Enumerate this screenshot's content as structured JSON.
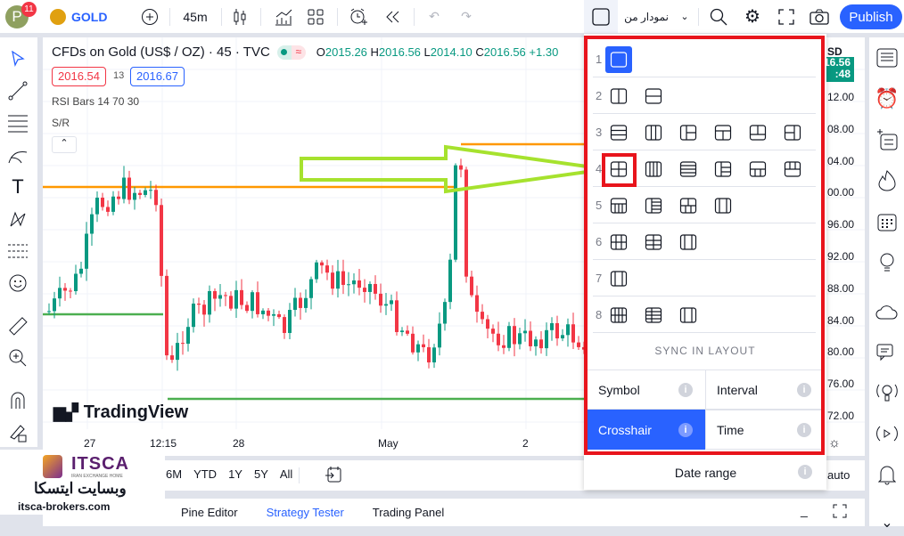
{
  "topbar": {
    "avatar_letter": "P",
    "notif_count": "11",
    "symbol": "GOLD",
    "interval": "45m",
    "layout_name": "نمودار من",
    "publish": "Publish"
  },
  "legend": {
    "title": "CFDs on Gold (US$ / OZ) · 45 · TVC",
    "o_label": "O",
    "o": "2015.26",
    "h_label": "H",
    "h": "2016.56",
    "l_label": "L",
    "l": "2014.10",
    "c_label": "C",
    "c": "2016.56",
    "change": "+1.30",
    "bid": "2016.54",
    "spread": "13",
    "ask": "2016.67",
    "ind1": "RSI Bars 14 70 30",
    "ind2": "S/R"
  },
  "price_axis": {
    "currency": "SD",
    "last": "16.56",
    "countdown": ":48",
    "labels": [
      "12.00",
      "08.00",
      "04.00",
      "00.00",
      "96.00",
      "92.00",
      "88.00",
      "84.00",
      "80.00",
      "76.00",
      "72.00"
    ]
  },
  "time_axis": [
    "27",
    "12:15",
    "28",
    "May",
    "2"
  ],
  "watermark": "TradingView",
  "ranges": [
    "6M",
    "YTD",
    "1Y",
    "5Y",
    "All"
  ],
  "auto": "auto",
  "bottom_tabs": [
    "Pine Editor",
    "Strategy Tester",
    "Trading Panel"
  ],
  "logo": {
    "brand": "ITSCA",
    "tagline": "IRAN EXCHANGE HOME",
    "persian": "وبسایت ایتسکا",
    "site": "itsca-brokers.com"
  },
  "layout_popup": {
    "rows": [
      {
        "n": "1",
        "count": 1
      },
      {
        "n": "2",
        "count": 2
      },
      {
        "n": "3",
        "count": 6
      },
      {
        "n": "4",
        "count": 6
      },
      {
        "n": "5",
        "count": 4
      },
      {
        "n": "6",
        "count": 3
      },
      {
        "n": "7",
        "count": 1
      },
      {
        "n": "8",
        "count": 3
      }
    ],
    "selected": "1",
    "highlighted": "4-1",
    "sync_title": "SYNC IN LAYOUT",
    "sync": {
      "symbol": "Symbol",
      "interval": "Interval",
      "crosshair": "Crosshair",
      "time": "Time",
      "date_range": "Date range"
    },
    "sync_active": "Crosshair"
  },
  "colors": {
    "accent": "#2962ff",
    "up": "#089981",
    "down": "#f23645",
    "annotation": "#e8141c",
    "arrow": "#a6e22e",
    "sr_orange": "#ff9800",
    "sr_green": "#4caf50"
  }
}
